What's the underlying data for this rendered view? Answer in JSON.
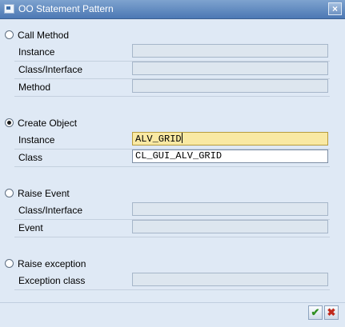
{
  "window": {
    "title": "OO Statement Pattern",
    "close_symbol": "×"
  },
  "sections": {
    "call_method": {
      "label": "Call Method",
      "selected": false,
      "fields": [
        {
          "label": "Instance",
          "value": ""
        },
        {
          "label": "Class/Interface",
          "value": ""
        },
        {
          "label": "Method",
          "value": ""
        }
      ]
    },
    "create_object": {
      "label": "Create Object",
      "selected": true,
      "fields": [
        {
          "label": "Instance",
          "value": "ALV_GRID"
        },
        {
          "label": "Class",
          "value": "CL_GUI_ALV_GRID"
        }
      ]
    },
    "raise_event": {
      "label": "Raise Event",
      "selected": false,
      "fields": [
        {
          "label": "Class/Interface",
          "value": ""
        },
        {
          "label": "Event",
          "value": ""
        }
      ]
    },
    "raise_exception": {
      "label": "Raise exception",
      "selected": false,
      "fields": [
        {
          "label": "Exception class",
          "value": ""
        }
      ]
    }
  },
  "buttons": {
    "confirm_symbol": "✔",
    "cancel_symbol": "✖"
  },
  "colors": {
    "titlebar": "#4c78b4",
    "dialog_bg": "#dfe9f5",
    "focused_field": "#f9e9a3",
    "confirm": "#2f8f20",
    "cancel": "#c02a1d"
  }
}
